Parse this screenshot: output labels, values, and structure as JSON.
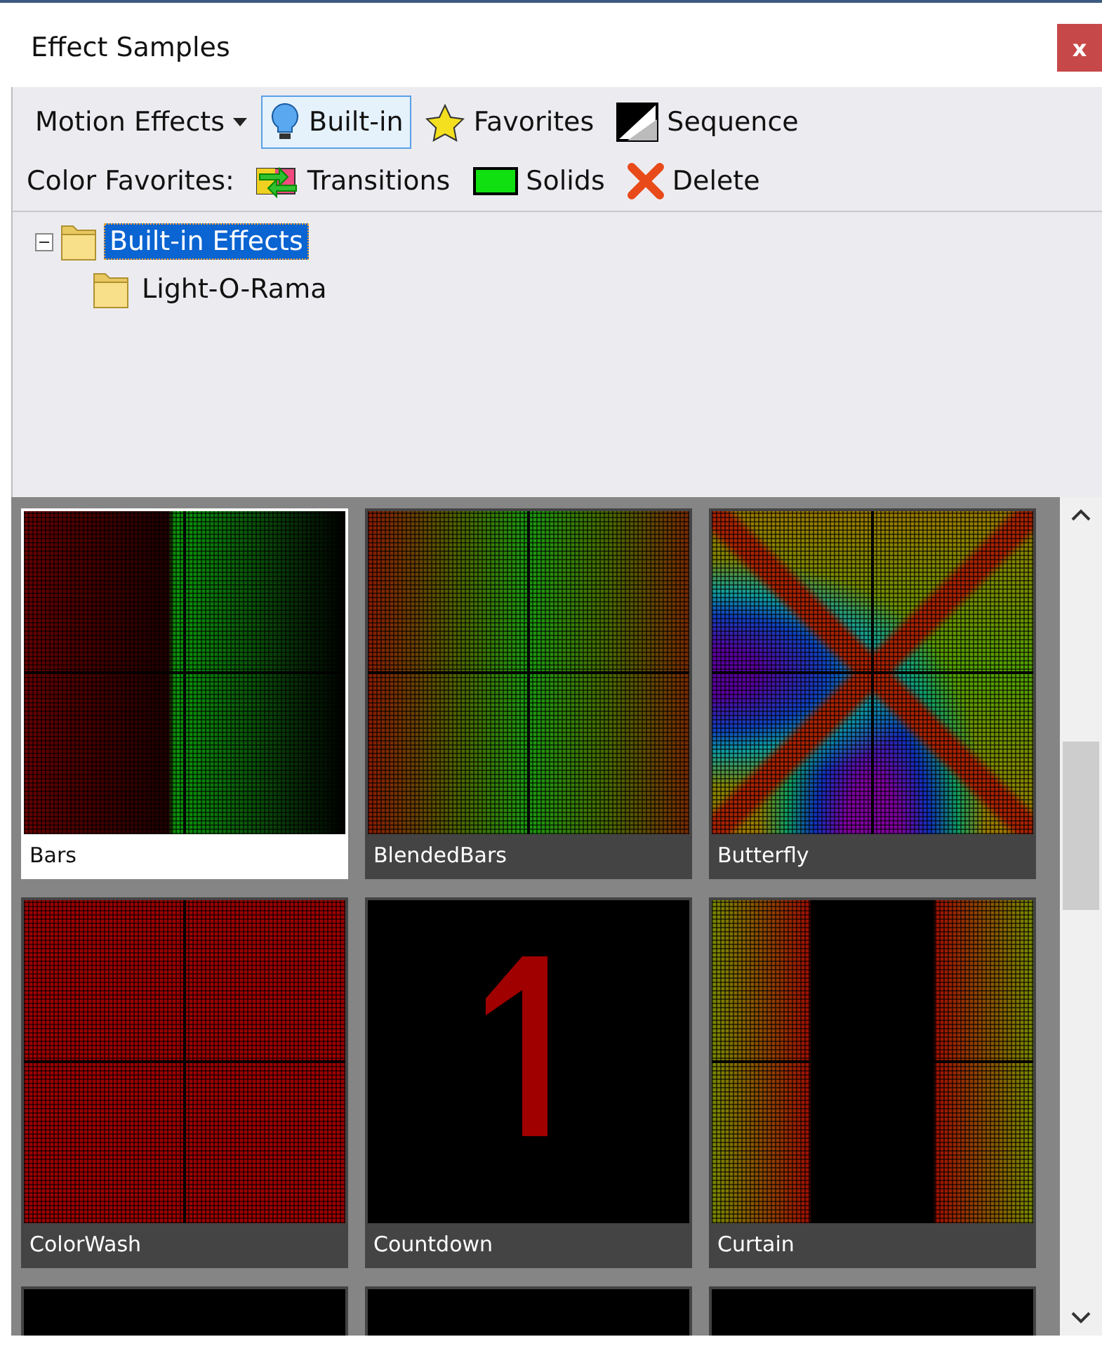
{
  "window": {
    "title": "Effect Samples",
    "close": "x"
  },
  "toolbar": {
    "items": [
      {
        "kind": "dropdown",
        "label": "Motion Effects"
      },
      {
        "kind": "toggle",
        "label": "Built-in",
        "selected": true
      },
      {
        "kind": "toggle",
        "label": "Favorites",
        "selected": false
      },
      {
        "kind": "toggle",
        "label": "Sequence",
        "selected": false
      }
    ]
  },
  "color_favorites": {
    "label": "Color Favorites:",
    "buttons": [
      "Transitions",
      "Solids",
      "Delete"
    ]
  },
  "tree": [
    {
      "label": "Built-in Effects",
      "expanded": true,
      "selected": true,
      "children": [
        {
          "label": "Light-O-Rama",
          "selected": false
        }
      ]
    }
  ],
  "gallery": [
    {
      "label": "Bars",
      "kind": "bars",
      "selected": true
    },
    {
      "label": "BlendedBars",
      "kind": "blended",
      "selected": false
    },
    {
      "label": "Butterfly",
      "kind": "butterfly",
      "selected": false
    },
    {
      "label": "ColorWash",
      "kind": "wash",
      "selected": false
    },
    {
      "label": "Countdown",
      "kind": "countdown",
      "selected": false
    },
    {
      "label": "Curtain",
      "kind": "curtain",
      "selected": false
    },
    {
      "kind": "dark",
      "selected": false
    },
    {
      "kind": "dots",
      "selected": false
    },
    {
      "kind": "line",
      "selected": false
    }
  ]
}
